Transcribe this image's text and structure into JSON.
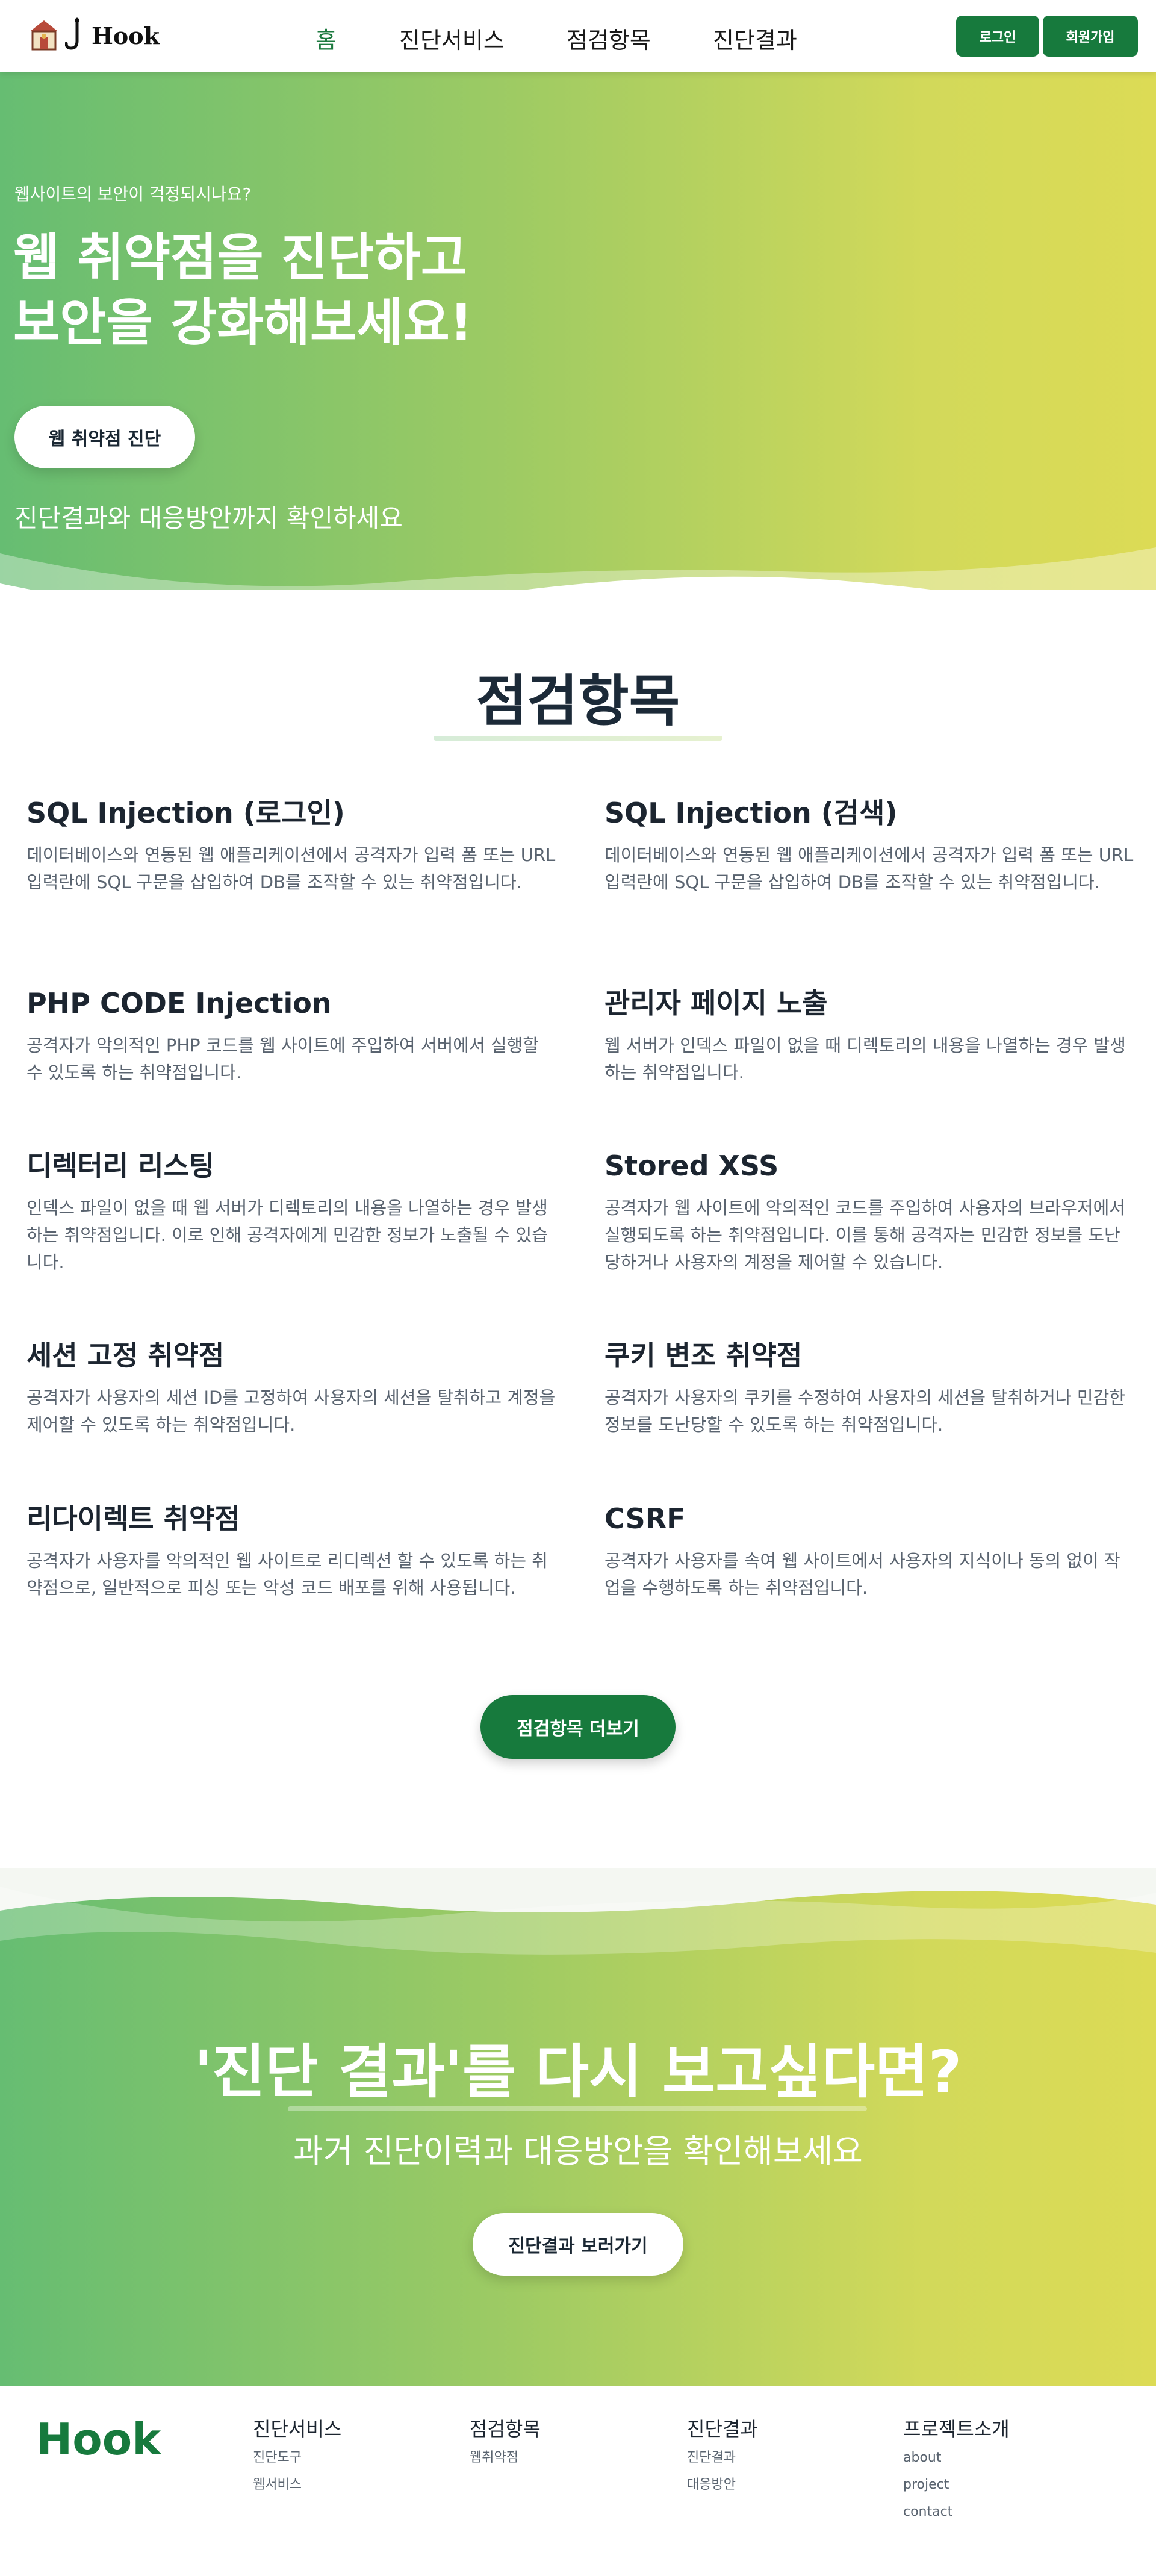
{
  "header": {
    "logo_text": "Hook",
    "nav": [
      {
        "label": "홈",
        "active": true
      },
      {
        "label": "진단서비스",
        "active": false
      },
      {
        "label": "점검항목",
        "active": false
      },
      {
        "label": "진단결과",
        "active": false
      }
    ],
    "login_label": "로그인",
    "signup_label": "회원가입"
  },
  "hero": {
    "kicker": "웹사이트의 보안이 걱정되시나요?",
    "title_line1": "웹 취약점을 진단하고",
    "title_line2": "보안을 강화해보세요!",
    "button_label": "웹 취약점 진단",
    "subtitle": "진단결과와 대응방안까지 확인하세요"
  },
  "checklist": {
    "title": "점검항목",
    "items": [
      {
        "title": "SQL Injection (로그인)",
        "desc": "데이터베이스와 연동된 웹 애플리케이션에서 공격자가 입력 폼 또는 URL 입력란에 SQL 구문을 삽입하여 DB를 조작할 수 있는 취약점입니다."
      },
      {
        "title": "SQL Injection (검색)",
        "desc": "데이터베이스와 연동된 웹 애플리케이션에서 공격자가 입력 폼 또는 URL 입력란에 SQL 구문을 삽입하여 DB를 조작할 수 있는 취약점입니다."
      },
      {
        "title": "PHP CODE Injection",
        "desc": "공격자가 악의적인 PHP 코드를 웹 사이트에 주입하여 서버에서 실행할 수 있도록 하는 취약점입니다."
      },
      {
        "title": "관리자 페이지 노출",
        "desc": "웹 서버가 인덱스 파일이 없을 때 디렉토리의 내용을 나열하는 경우 발생하는 취약점입니다."
      },
      {
        "title": "디렉터리 리스팅",
        "desc": "인덱스 파일이 없을 때 웹 서버가 디렉토리의 내용을 나열하는 경우 발생하는 취약점입니다. 이로 인해 공격자에게 민감한 정보가 노출될 수 있습니다."
      },
      {
        "title": "Stored XSS",
        "desc": "공격자가 웹 사이트에 악의적인 코드를 주입하여 사용자의 브라우저에서 실행되도록 하는 취약점입니다. 이를 통해 공격자는 민감한 정보를 도난당하거나 사용자의 계정을 제어할 수 있습니다."
      },
      {
        "title": "세션 고정 취약점",
        "desc": "공격자가 사용자의 세션 ID를 고정하여 사용자의 세션을 탈취하고 계정을 제어할 수 있도록 하는 취약점입니다."
      },
      {
        "title": "쿠키 변조 취약점",
        "desc": "공격자가 사용자의 쿠키를 수정하여 사용자의 세션을 탈취하거나 민감한 정보를 도난당할 수 있도록 하는 취약점입니다."
      },
      {
        "title": "리다이렉트 취약점",
        "desc": "공격자가 사용자를 악의적인 웹 사이트로 리디렉션 할 수 있도록 하는 취약점으로, 일반적으로 피싱 또는 악성 코드 배포를 위해 사용됩니다."
      },
      {
        "title": "CSRF",
        "desc": "공격자가 사용자를 속여 웹 사이트에서 사용자의 지식이나 동의 없이 작업을 수행하도록 하는 취약점입니다."
      }
    ],
    "more_label": "점검항목 더보기"
  },
  "cta": {
    "title": "'진단 결과'를 다시 보고싶다면?",
    "subtitle": "과거 진단이력과 대응방안을 확인해보세요",
    "button_label": "진단결과 보러가기"
  },
  "footer": {
    "logo": "Hook",
    "columns": [
      {
        "title": "진단서비스",
        "links": [
          "진단도구",
          "웹서비스"
        ]
      },
      {
        "title": "점검항목",
        "links": [
          "웹취약점"
        ]
      },
      {
        "title": "진단결과",
        "links": [
          "진단결과",
          "대응방안"
        ]
      },
      {
        "title": "프로젝트소개",
        "links": [
          "about",
          "project",
          "contact"
        ]
      }
    ]
  },
  "colors": {
    "brand_green": "#177a3d",
    "gradient_start": "#66bd72",
    "gradient_end": "#dcdb55"
  },
  "icons": [
    "house-icon",
    "hook-icon"
  ]
}
